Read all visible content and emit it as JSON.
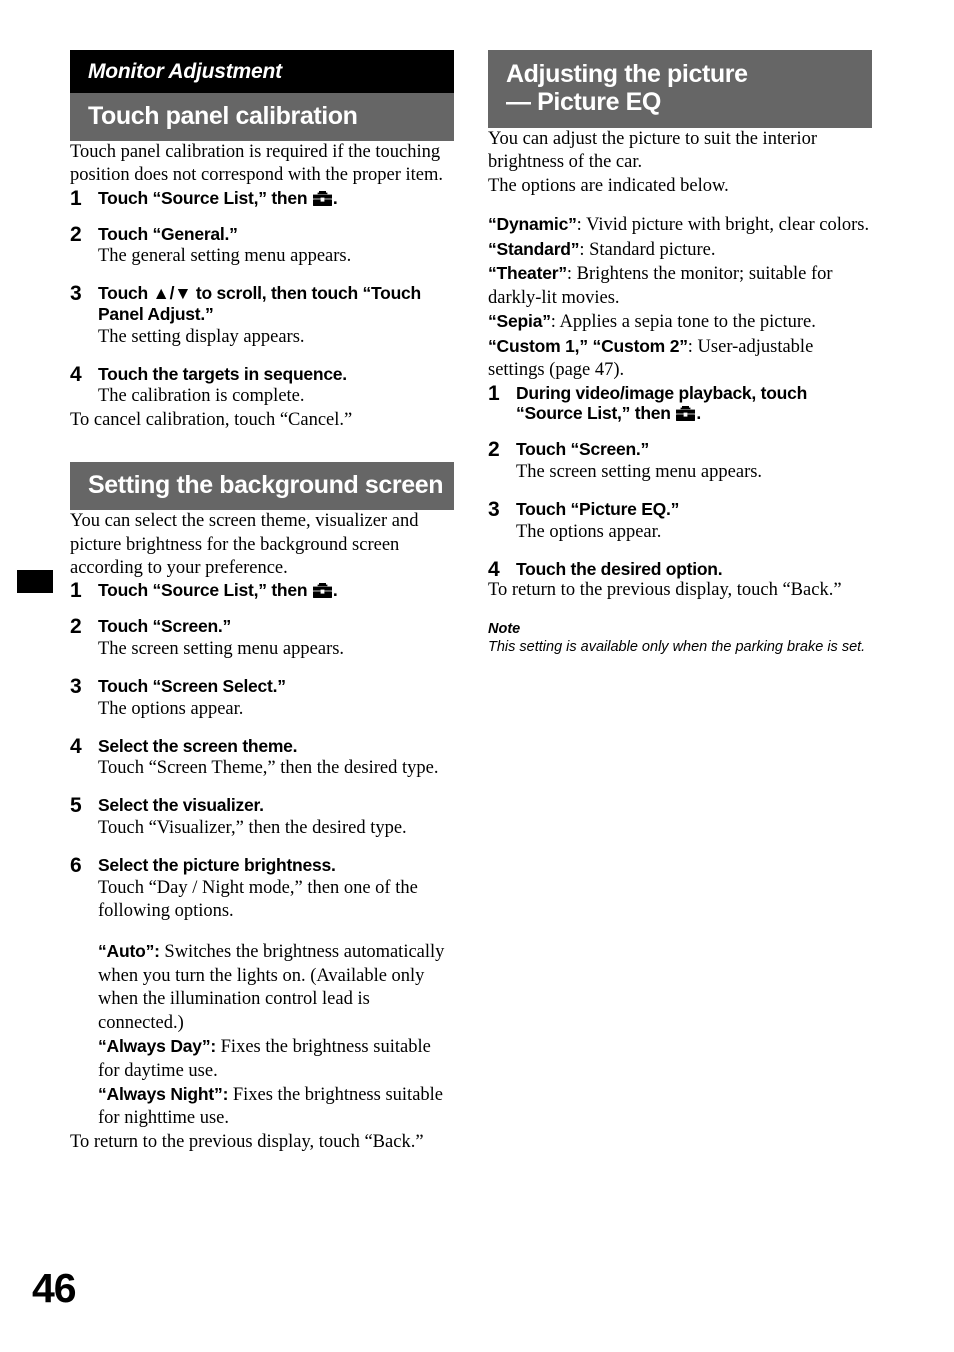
{
  "page": {
    "number": "46"
  },
  "icons": {
    "toolbox": "toolbox-icon",
    "arrow_up": "▲",
    "arrow_down": "▼"
  },
  "colors": {
    "banner_black": "#000000",
    "banner_gray": "#666666",
    "text": "#000000",
    "banner_text": "#ffffff"
  },
  "left_column": {
    "chapter_banner": "Monitor Adjustment",
    "section1": {
      "heading": "Touch panel calibration",
      "intro": "Touch panel calibration is required if the touching position does not correspond with the proper item.",
      "steps": [
        {
          "num": "1",
          "title_before": "Touch “Source List,” then ",
          "title_after": ".",
          "has_icon": true,
          "desc": ""
        },
        {
          "num": "2",
          "title_before": "Touch “General.”",
          "title_after": "",
          "has_icon": false,
          "desc": "The general setting menu appears."
        },
        {
          "num": "3",
          "title_before": "Touch ▲/▼ to scroll, then touch “Touch Panel Adjust.”",
          "title_after": "",
          "has_icon": false,
          "desc": "The setting display appears."
        },
        {
          "num": "4",
          "title_before": "Touch the targets in sequence.",
          "title_after": "",
          "has_icon": false,
          "desc": "The calibration is complete."
        }
      ],
      "closing": "To cancel calibration, touch “Cancel.”"
    },
    "section2": {
      "heading": "Setting the background screen",
      "intro": "You can select the screen theme, visualizer and picture brightness for the background screen according to your preference.",
      "steps": [
        {
          "num": "1",
          "title_before": "Touch “Source List,” then ",
          "title_after": ".",
          "has_icon": true,
          "desc": ""
        },
        {
          "num": "2",
          "title_before": "Touch “Screen.”",
          "title_after": "",
          "has_icon": false,
          "desc": "The screen setting menu appears."
        },
        {
          "num": "3",
          "title_before": "Touch “Screen Select.”",
          "title_after": "",
          "has_icon": false,
          "desc": "The options appear."
        },
        {
          "num": "4",
          "title_before": "Select the screen theme.",
          "title_after": "",
          "has_icon": false,
          "desc": "Touch “Screen Theme,” then the desired type."
        },
        {
          "num": "5",
          "title_before": "Select the visualizer.",
          "title_after": "",
          "has_icon": false,
          "desc": "Touch “Visualizer,” then the desired type."
        },
        {
          "num": "6",
          "title_before": "Select the picture brightness.",
          "title_after": "",
          "has_icon": false,
          "desc": "Touch “Day / Night mode,” then one of the following options."
        }
      ],
      "brightness_options": [
        {
          "term": "“Auto”:",
          "text": " Switches the brightness automatically when you turn the lights on. (Available only when the illumination control lead is connected.)"
        },
        {
          "term": "“Always Day”:",
          "text": " Fixes the brightness suitable for daytime use."
        },
        {
          "term": "“Always Night”:",
          "text": " Fixes the brightness suitable for nighttime use."
        }
      ],
      "closing": "To return to the previous display, touch “Back.”"
    }
  },
  "right_column": {
    "section1": {
      "heading_line1": "Adjusting the picture",
      "heading_line2": "— Picture EQ",
      "intro": "You can adjust the picture to suit the interior brightness of the car.\nThe options are indicated below.",
      "picture_eq_options": [
        {
          "term": "“Dynamic”",
          "text": ": Vivid picture with bright, clear colors."
        },
        {
          "term": "“Standard”",
          "text": ": Standard picture."
        },
        {
          "term": "“Theater”",
          "text": ": Brightens the monitor; suitable for darkly-lit movies."
        },
        {
          "term": "“Sepia”",
          "text": ": Applies a sepia tone to the picture."
        },
        {
          "term": "“Custom 1,” “Custom 2”",
          "text": ": User-adjustable settings (page 47)."
        }
      ],
      "steps": [
        {
          "num": "1",
          "title_before": "During video/image playback, touch “Source List,” then ",
          "title_after": ".",
          "has_icon": true,
          "desc": ""
        },
        {
          "num": "2",
          "title_before": "Touch “Screen.”",
          "title_after": "",
          "has_icon": false,
          "desc": "The screen setting menu appears."
        },
        {
          "num": "3",
          "title_before": "Touch “Picture EQ.”",
          "title_after": "",
          "has_icon": false,
          "desc": "The options appear."
        },
        {
          "num": "4",
          "title_before": "Touch the desired option.",
          "title_after": "",
          "has_icon": false,
          "desc": ""
        }
      ],
      "closing": "To return to the previous display, touch “Back.”",
      "note_heading": "Note",
      "note_text": "This setting is available only when the parking brake is set."
    }
  }
}
